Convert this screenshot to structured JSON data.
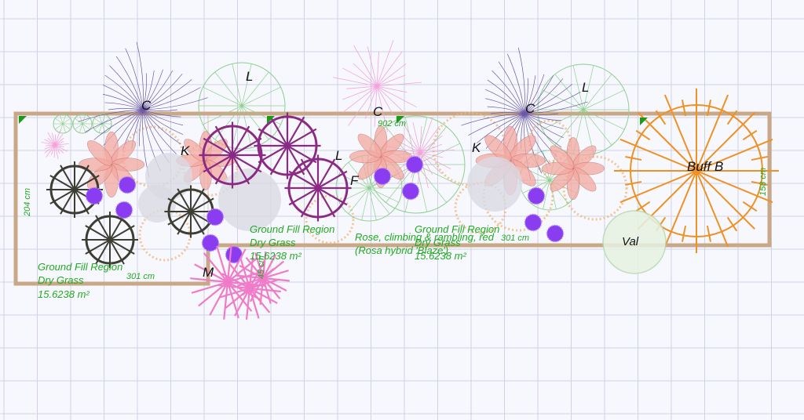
{
  "colors": {
    "background": "#f7f8fd",
    "grid": "#cfd3e6",
    "bed_outline": "#c8a887",
    "label_green": "#22aa22",
    "aster_purple": "#8a3cf0",
    "magenta": "#8a2a84",
    "dark_wheel": "#3d3d33",
    "orange": "#ef9125",
    "pink": "#f07bc8"
  },
  "plant_letters": {
    "c1": "C",
    "c2": "C",
    "c3": "C",
    "l1": "L",
    "l2": "L",
    "l3": "L",
    "k1": "K",
    "k2": "K",
    "f1": "F",
    "m1": "M",
    "buff": "Buff B",
    "val": "Val"
  },
  "regions": [
    {
      "line1": "Ground Fill Region",
      "line2": "Dry Grass",
      "line3": "15.6238 m²"
    },
    {
      "line1": "Ground Fill Region",
      "line2": "Dry Grass",
      "line3": "15.6238 m²"
    },
    {
      "line1": "Ground Fill Region",
      "line2": "Dry Grass",
      "line3": "15.6238 m²"
    }
  ],
  "rose_label": {
    "line1": "Rose, climbing & rambling, red",
    "line2": "(Rosa hybrid 'Blaze')"
  },
  "dimensions": {
    "d1": "204 cm",
    "d2": "301 cm",
    "d3": "902 cm",
    "d4": "158 cm",
    "d5": "45 cm",
    "d6": "301 cm"
  }
}
